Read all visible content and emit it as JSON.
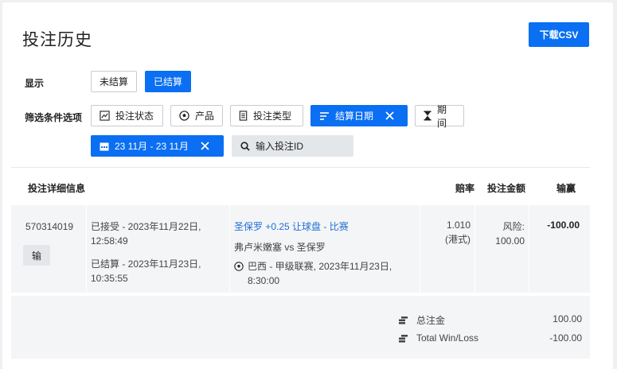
{
  "header": {
    "title": "投注历史",
    "download_label": "下载CSV"
  },
  "display": {
    "label": "显示",
    "options": [
      {
        "label": "未结算",
        "active": false
      },
      {
        "label": "已结算",
        "active": true
      }
    ]
  },
  "filters": {
    "label": "筛选条件选项",
    "items": [
      {
        "label": "投注状态",
        "icon": "chart-icon"
      },
      {
        "label": "产品",
        "icon": "soccer-ball-icon"
      },
      {
        "label": "投注类型",
        "icon": "document-icon"
      },
      {
        "label": "结算日期",
        "icon": "sort-icon",
        "active": true
      },
      {
        "label": "期间",
        "icon": "hourglass-icon"
      }
    ],
    "date_range": "23 11月 - 23 11月",
    "bet_id_placeholder": "输入投注ID"
  },
  "table": {
    "headers": {
      "details": "投注详细信息",
      "odds": "赔率",
      "stake": "投注金额",
      "win_loss": "输赢"
    },
    "rows": [
      {
        "bet_id": "570314019",
        "result_badge": "输",
        "accepted_line1": "已接受 - 2023年11月22日,",
        "accepted_line2": "12:58:49",
        "settled_line1": "已结算 - 2023年11月23日,",
        "settled_line2": "10:35:55",
        "selection": "圣保罗 +0.25 让球盘 - 比赛",
        "match": "弗卢米嫩塞 vs 圣保罗",
        "league_line1": "巴西 - 甲级联赛, 2023年11月23日,",
        "league_line2": "8:30:00",
        "odds_value": "1.010",
        "odds_format": "(港式)",
        "stake_label": "风险:",
        "stake_value": "100.00",
        "win_loss": "-100.00"
      }
    ]
  },
  "summary": {
    "total_stake_label": "总注金",
    "total_stake_value": "100.00",
    "total_winloss_label": "Total Win/Loss",
    "total_winloss_value": "-100.00"
  },
  "colors": {
    "accent": "#0a6ff2",
    "link": "#1f6fd6"
  }
}
